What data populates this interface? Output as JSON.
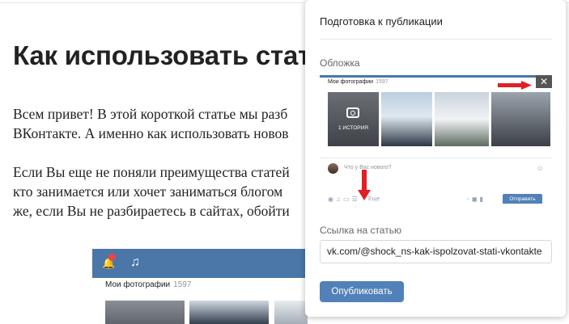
{
  "article": {
    "title": "Как использовать стат",
    "p1_line1": "Всем привет! В этой короткой статье мы разб",
    "p1_line2": "ВКонтакте. А именно как использовать новов",
    "p2_line1": "Если Вы еще не поняли преимущества статей",
    "p2_line2": "кто занимается или хочет заниматься блогом",
    "p2_line3": "же, если Вы не разбираетесь в сайтах, обойти",
    "image": {
      "photos_label": "Мои фотографии",
      "photos_count": "1597",
      "notification_count": "2",
      "bell_icon": "bell-icon",
      "music_icon": "music-note-icon"
    }
  },
  "modal": {
    "title": "Подготовка к публикации",
    "cover_label": "Обложка",
    "cover": {
      "photos_label": "Мои фотографии",
      "photos_count": "1597",
      "story_label": "1 ИСТОРИЯ",
      "post_placeholder": "Что у Вас нового?",
      "more_label": "Еще",
      "send_label": "Отправить",
      "close_icon": "close-icon"
    },
    "link_label": "Ссылка на статью",
    "link_value": "vk.com/@shock_ns-kak-ispolzovat-stati-vkontakte",
    "publish_label": "Опубликовать"
  },
  "colors": {
    "vk_blue": "#4a76a8",
    "button_blue": "#5181b8",
    "annotation_red": "#e01f26"
  }
}
